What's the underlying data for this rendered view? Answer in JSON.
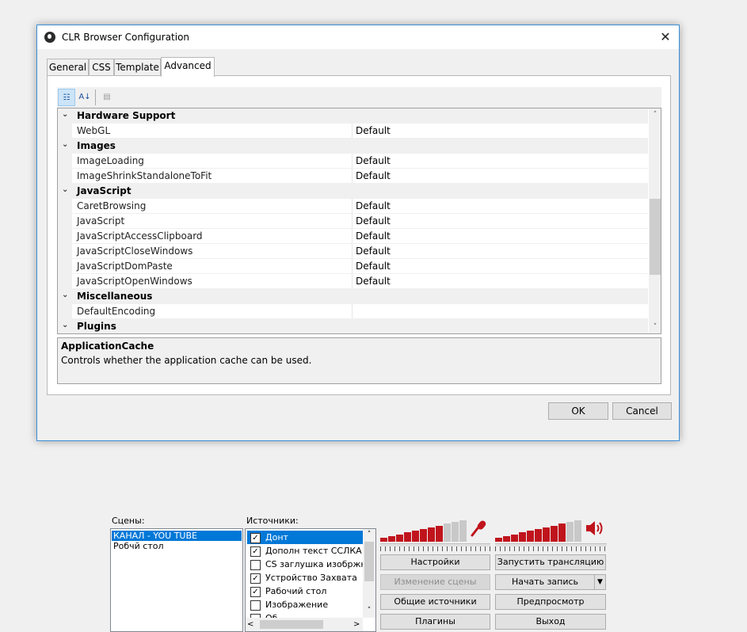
{
  "dialog": {
    "title": "CLR Browser Configuration",
    "close_glyph": "✕",
    "tabs": [
      {
        "label": "General"
      },
      {
        "label": "CSS"
      },
      {
        "label": "Template"
      },
      {
        "label": "Advanced"
      }
    ],
    "active_tab": "Advanced",
    "toolbar": {
      "categorized_glyph": "☷",
      "alpha_glyph": "A↓",
      "pages_glyph": "▤"
    },
    "grid": {
      "rows": [
        {
          "type": "category",
          "label": "Hardware Support",
          "chevron": "⌄"
        },
        {
          "type": "property",
          "name": "WebGL",
          "value": "Default"
        },
        {
          "type": "category",
          "label": "Images",
          "chevron": "⌄"
        },
        {
          "type": "property",
          "name": "ImageLoading",
          "value": "Default"
        },
        {
          "type": "property",
          "name": "ImageShrinkStandaloneToFit",
          "value": "Default"
        },
        {
          "type": "category",
          "label": "JavaScript",
          "chevron": "⌄"
        },
        {
          "type": "property",
          "name": "CaretBrowsing",
          "value": "Default"
        },
        {
          "type": "property",
          "name": "JavaScript",
          "value": "Default"
        },
        {
          "type": "property",
          "name": "JavaScriptAccessClipboard",
          "value": "Default"
        },
        {
          "type": "property",
          "name": "JavaScriptCloseWindows",
          "value": "Default"
        },
        {
          "type": "property",
          "name": "JavaScriptDomPaste",
          "value": "Default"
        },
        {
          "type": "property",
          "name": "JavaScriptOpenWindows",
          "value": "Default"
        },
        {
          "type": "category",
          "label": "Miscellaneous",
          "chevron": "⌄"
        },
        {
          "type": "property",
          "name": "DefaultEncoding",
          "value": ""
        },
        {
          "type": "category",
          "label": "Plugins",
          "chevron": "⌄"
        }
      ],
      "scroll_up": "˄",
      "scroll_down": "˅"
    },
    "help": {
      "title": "ApplicationCache",
      "description": "Controls whether the application cache can be used."
    },
    "ok_label": "OK",
    "cancel_label": "Cancel"
  },
  "obs": {
    "scenes_label": "Сцены:",
    "scenes": [
      {
        "label": "КАНАЛ - YOU TUBE",
        "selected": true
      },
      {
        "label": "Робчй стол",
        "selected": false
      }
    ],
    "sources_label": "Источники:",
    "sources": [
      {
        "label": "Донт",
        "checked": true,
        "selected": true
      },
      {
        "label": "Дополн текст ССЛКА В I",
        "checked": true,
        "selected": false
      },
      {
        "label": "CS заглушка изобржне",
        "checked": false,
        "selected": false
      },
      {
        "label": "Устройство Захвата",
        "checked": true,
        "selected": false
      },
      {
        "label": "Рабочий стол",
        "checked": true,
        "selected": false
      },
      {
        "label": "Изображение",
        "checked": false,
        "selected": false
      },
      {
        "label": "Об...",
        "checked": false,
        "selected": false
      }
    ],
    "check_glyph": "✓",
    "scroll_up": "˄",
    "scroll_down": "˅",
    "scroll_left": "<",
    "scroll_right": ">",
    "mic_level": 0.7,
    "desktop_level": 0.85,
    "meter_color": "#c0141c",
    "buttons": {
      "settings": "Настройки",
      "start_stream": "Запустить трансляцию",
      "edit_scene": "Изменение сцены",
      "start_record": "Начать запись",
      "record_dropdown": "▼",
      "global_sources": "Общие источники",
      "preview": "Предпросмотр",
      "plugins": "Плагины",
      "exit": "Выход"
    }
  }
}
